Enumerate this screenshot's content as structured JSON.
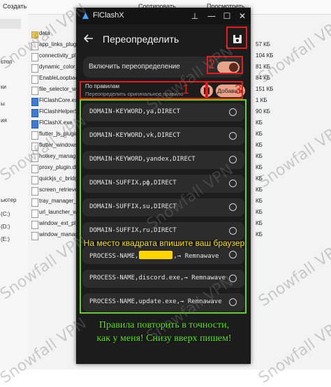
{
  "explorer": {
    "toolbar": {
      "create": "Создать",
      "sort": "Сортировать",
      "view": "Просмотреть"
    },
    "nav": [
      {
        "label": "стол"
      },
      {
        "label": "ки"
      },
      {
        "label": "ы"
      },
      {
        "label": "ия"
      },
      {
        "label": "(C:)"
      },
      {
        "label": "(D:)"
      },
      {
        "label": "(E:)"
      }
    ],
    "nav_header": "ьютер",
    "files": [
      {
        "name": "data",
        "size": "",
        "type": "folder"
      },
      {
        "name": "app_links_plugin.dll",
        "size": "",
        "type": "file"
      },
      {
        "name": "connectivity_plus_plugin.dll",
        "size": "",
        "type": "file"
      },
      {
        "name": "dynamic_color_plugin.dll",
        "size": "",
        "type": "file"
      },
      {
        "name": "EnableLoopback.exe",
        "size": "",
        "type": "file"
      },
      {
        "name": "file_selector_windows_plugin.dll",
        "size": "",
        "type": "file"
      },
      {
        "name": "FlClashCore.exe",
        "size": "",
        "type": "exe"
      },
      {
        "name": "FlClashHelperService.exe",
        "size": "",
        "type": "exe"
      },
      {
        "name": "FlClashX.exe",
        "size": "",
        "type": "exe"
      },
      {
        "name": "flutter_js_plugin.dll",
        "size": "",
        "type": "file"
      },
      {
        "name": "flutter_windows.dll",
        "size": "",
        "type": "file"
      },
      {
        "name": "hotkey_manager_windows_plugin.dll",
        "size": "",
        "type": "file"
      },
      {
        "name": "proxy_plugin.dll",
        "size": "",
        "type": "file"
      },
      {
        "name": "quickjs_c_bridge.dll",
        "size": "",
        "type": "file"
      },
      {
        "name": "screen_retriever_windows_plugin.dll",
        "size": "",
        "type": "file"
      },
      {
        "name": "tray_manager_plugin.dll",
        "size": "",
        "type": "file"
      },
      {
        "name": "url_launcher_windows_plugin.dll",
        "size": "",
        "type": "file"
      },
      {
        "name": "window_ext_plugin.dll",
        "size": "",
        "type": "file"
      },
      {
        "name": "window_manager_plugin.dll",
        "size": "",
        "type": "file"
      }
    ],
    "sizes": [
      "57 КБ",
      "104 КБ",
      "81 КБ",
      "84 КБ",
      "151 КБ",
      "1 КБ",
      "90 КБ",
      "КБ",
      "КБ",
      "КБ",
      "КБ",
      "КБ",
      "КБ",
      "КБ",
      "КБ",
      "КБ",
      "КБ",
      "КБ"
    ]
  },
  "app": {
    "title": "FlClashX",
    "header_title": "Переопределить",
    "toggle_label": "Включить переопределение",
    "toggle_on": true,
    "rules_title": "По правилам",
    "rules_subtitle": "Переопределить оригинальное правило",
    "add_button": "Добавить",
    "rules": [
      "DOMAIN-KEYWORD,ya,DIRECT",
      "DOMAIN-KEYWORD,vk,DIRECT",
      "DOMAIN-KEYWORD,yandex,DIRECT",
      "DOMAIN-SUFFIX,рф,DIRECT",
      "DOMAIN-SUFFIX,su,DIRECT",
      "DOMAIN-SUFFIX,ru,DIRECT"
    ],
    "rule_browser_prefix": "PROCESS-NAME,",
    "rule_browser_suffix": ",→ Remnawave",
    "rules_after": [
      "PROCESS-NAME,discord.exe,→ Remnawave",
      "PROCESS-NAME,update.exe,→ Remnawave"
    ]
  },
  "annotations": {
    "num1": "1",
    "num2": "2",
    "num3": "3",
    "caption_mid": "На место квадрата впишите ваш браузер",
    "caption_bottom_1": "Правила повторить в точности,",
    "caption_bottom_2": "как у меня! Снизу вверх пишем!",
    "watermark": "Snowfall VPN"
  },
  "colors": {
    "accent": "#e7a48a",
    "annotation_red": "#e21b1b",
    "annotation_green": "#6ad11a",
    "highlight_yellow": "#ffd400"
  }
}
